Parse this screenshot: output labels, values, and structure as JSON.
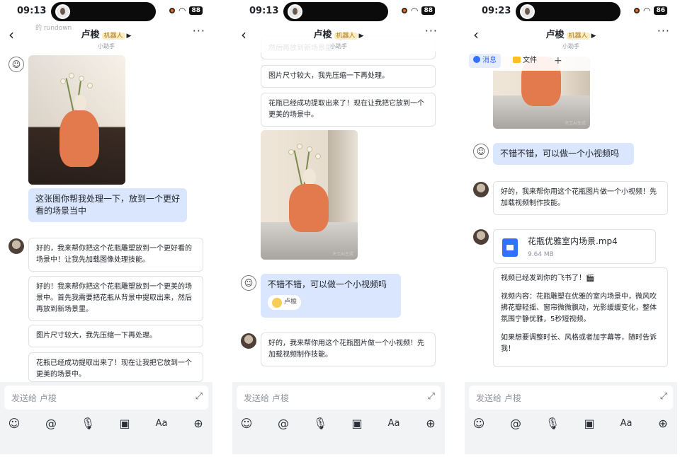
{
  "status_bar": [
    {
      "time": "09:13",
      "battery": "88"
    },
    {
      "time": "09:13",
      "battery": "88"
    },
    {
      "time": "09:23",
      "battery": "86"
    }
  ],
  "header": {
    "name": "卢梭",
    "badge": "机器人",
    "subtitle": "小助手",
    "more": "···",
    "back": "‹",
    "ghost_text": "的 rundown"
  },
  "tabs": {
    "messages": "消息",
    "files": "文件",
    "add": "+"
  },
  "input": {
    "placeholder": "发送给 卢梭"
  },
  "toolbar_icons": [
    "emoji-icon",
    "mention-icon",
    "microphone-icon",
    "image-icon",
    "text-format-icon",
    "add-icon"
  ],
  "toolbar_glyphs": [
    "☺",
    "@",
    "🎙",
    "▣",
    "Aa",
    "⊕"
  ],
  "screen1": {
    "user_message": "这张图你帮我处理一下，放到一个更好看的场景当中",
    "replies": [
      "好的，我来帮你把这个花瓶雕塑放到一个更好看的场景中！让我先加载图像处理技能。",
      "好的！我来帮你把这个花瓶雕塑放到一个更美的场景中。首先我需要把花瓶从背景中提取出来，然后再放到新场景里。",
      "图片尺寸较大，我先压缩一下再处理。",
      "花瓶已经成功提取出来了！现在让我把它放到一个更美的场景中。"
    ]
  },
  "screen2": {
    "top_cut_text": "然后再放到新场景里。",
    "replies": [
      "图片尺寸较大，我先压缩一下再处理。",
      "花瓶已经成功提取出来了！现在让我把它放到一个更美的场景中。"
    ],
    "user_message": "不错不错，可以做一个小视频吗",
    "reaction_name": "卢梭",
    "reply_after": "好的，我来帮你用这个花瓶图片做一个小视频！先加载视频制作技能。",
    "watermark": "天工AI生成"
  },
  "screen3": {
    "user_message": "不错不错，可以做一个小视频吗",
    "reply": "好的，我来帮你用这个花瓶图片做一个小视频！先加载视频制作技能。",
    "file_name": "花瓶优雅室内场景.mp4",
    "file_size": "9.64 MB",
    "final_message": {
      "line1": "视频已经发到你的飞书了！🎬",
      "content": "视频内容：花瓶雕塑在优雅的室内场景中，微风吹拂花瓣轻摇、窗帘微微飘动，光影缓缓变化，整体氛围宁静优雅，5秒短视频。",
      "followup": "如果想要调整时长、风格或者加字幕等，随时告诉我！"
    },
    "watermark": "天工AI生成"
  }
}
